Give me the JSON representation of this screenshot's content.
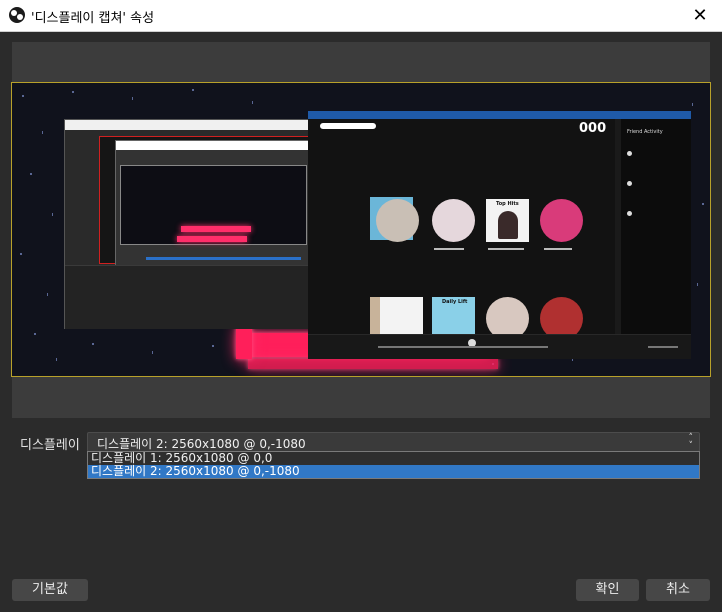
{
  "window": {
    "title": "'디스플레이 캡쳐' 속성",
    "close_glyph": "✕",
    "app_icon": "obs-icon"
  },
  "preview": {
    "nested_obs_window_title": "'디스플레이 캡쳐' 속성",
    "spotify": {
      "notification_count": "000",
      "friend_activity_title": "Friend Activity",
      "playlists": [
        {
          "name": "Top Hits"
        },
        {
          "name": "Daily Lift"
        }
      ]
    }
  },
  "display": {
    "label": "디스플레이",
    "selected_value": "디스플레이 2: 2560x1080 @ 0,-1080",
    "options": [
      {
        "label": "디스플레이 1: 2560x1080 @ 0,0",
        "selected": false
      },
      {
        "label": "디스플레이 2: 2560x1080 @ 0,-1080",
        "selected": true
      }
    ]
  },
  "buttons": {
    "defaults": "기본값",
    "ok": "확인",
    "cancel": "취소"
  },
  "colors": {
    "accent": "#3178c6",
    "preview_border": "#b8a12a",
    "neon": "#ff1f5a"
  }
}
